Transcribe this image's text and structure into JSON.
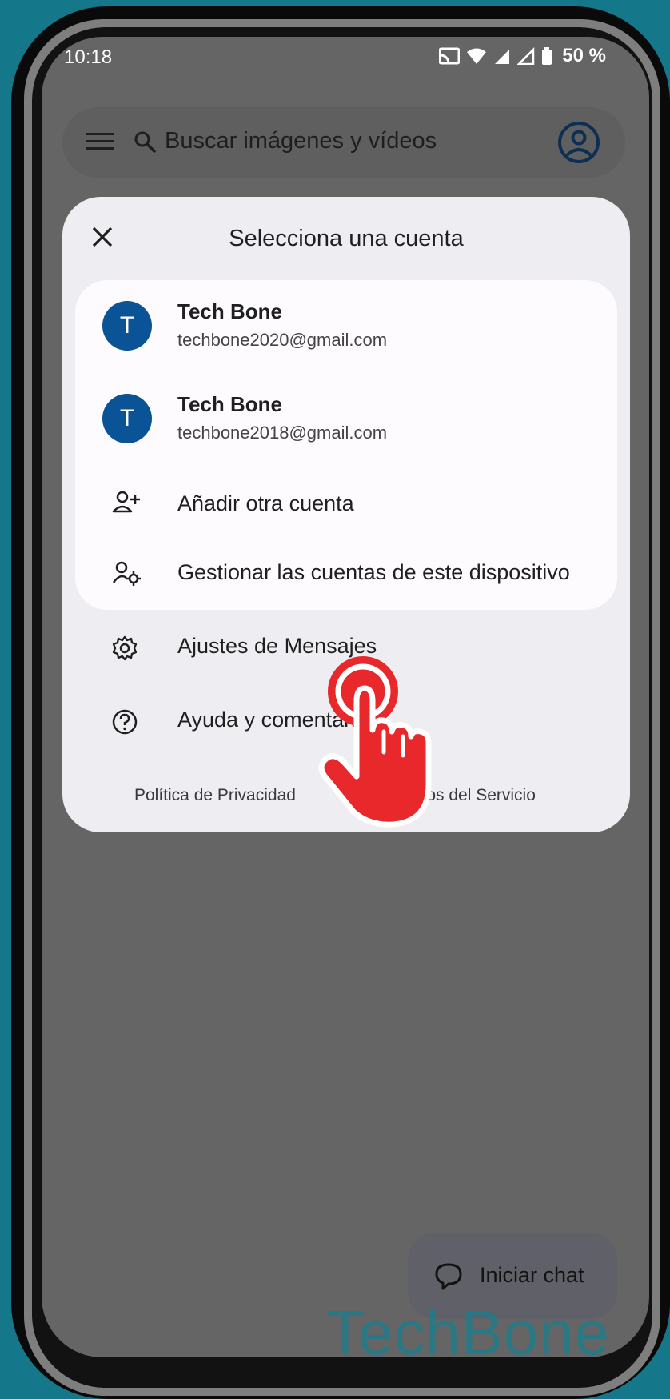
{
  "status_bar": {
    "time": "10:18",
    "battery": "50 %"
  },
  "search": {
    "placeholder": "Buscar imágenes y vídeos"
  },
  "dialog": {
    "title": "Selecciona una cuenta",
    "accounts": [
      {
        "initial": "T",
        "name": "Tech Bone",
        "email": "techbone2020@gmail.com"
      },
      {
        "initial": "T",
        "name": "Tech Bone",
        "email": "techbone2018@gmail.com"
      }
    ],
    "add_account": "Añadir otra cuenta",
    "manage_accounts": "Gestionar las cuentas de este dispositivo",
    "settings": "Ajustes de Mensajes",
    "help": "Ayuda y comentarios",
    "privacy": "Política de Privacidad",
    "terms": "Términos del Servicio"
  },
  "fab": {
    "label": "Iniciar chat"
  },
  "watermark": "TechBone",
  "colors": {
    "background": "#14788a",
    "avatar": "#0a5396",
    "tap_indicator": "#e8282b"
  },
  "icons": [
    "menu-icon",
    "search-icon",
    "account-circle-icon",
    "close-icon",
    "person-add-icon",
    "manage-accounts-icon",
    "gear-icon",
    "help-icon",
    "chat-icon",
    "tap-hand-icon"
  ]
}
